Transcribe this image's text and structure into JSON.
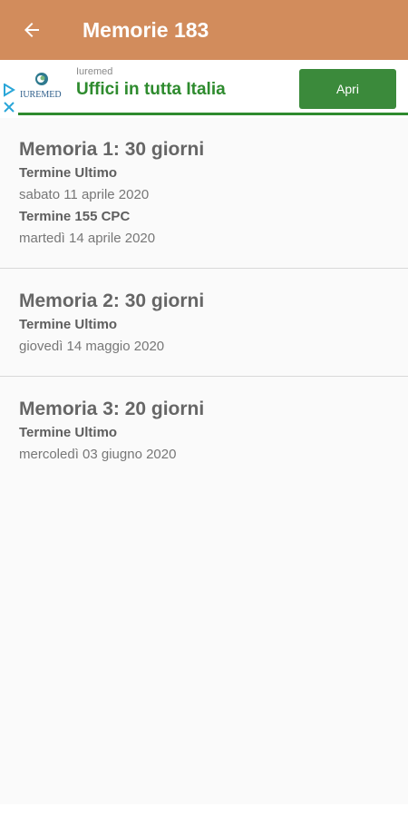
{
  "appbar": {
    "title": "Memorie 183",
    "back_icon": "arrow-left-icon"
  },
  "ad": {
    "brand": "Iuremed",
    "logo_text": "IUREMED",
    "headline": "Uffici in tutta Italia",
    "button_label": "Apri",
    "accent_color": "#2e8b2e"
  },
  "items": [
    {
      "title": "Memoria 1: 30 giorni",
      "deadlines": [
        {
          "label": "Termine Ultimo",
          "date": "sabato 11 aprile 2020"
        },
        {
          "label": "Termine 155 CPC",
          "date": "martedì 14 aprile 2020"
        }
      ]
    },
    {
      "title": "Memoria 2: 30 giorni",
      "deadlines": [
        {
          "label": "Termine Ultimo",
          "date": "giovedì 14 maggio 2020"
        }
      ]
    },
    {
      "title": "Memoria 3: 20 giorni",
      "deadlines": [
        {
          "label": "Termine Ultimo",
          "date": "mercoledì 03 giugno 2020"
        }
      ]
    }
  ],
  "colors": {
    "appbar": "#d28c5c",
    "ad_button": "#3b8a3b"
  }
}
